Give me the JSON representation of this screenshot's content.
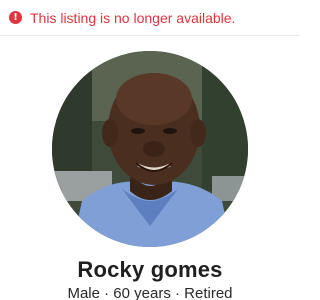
{
  "alert": {
    "icon": "exclamation-icon",
    "icon_glyph": "!",
    "text": "This listing is no longer available.",
    "color": "#e0343f"
  },
  "profile": {
    "photo": "profile-photo",
    "name": "Rocky gomes",
    "gender": "Male",
    "age": "60 years",
    "occupation": "Retired",
    "summary": "Male · 60 years · Retired"
  }
}
